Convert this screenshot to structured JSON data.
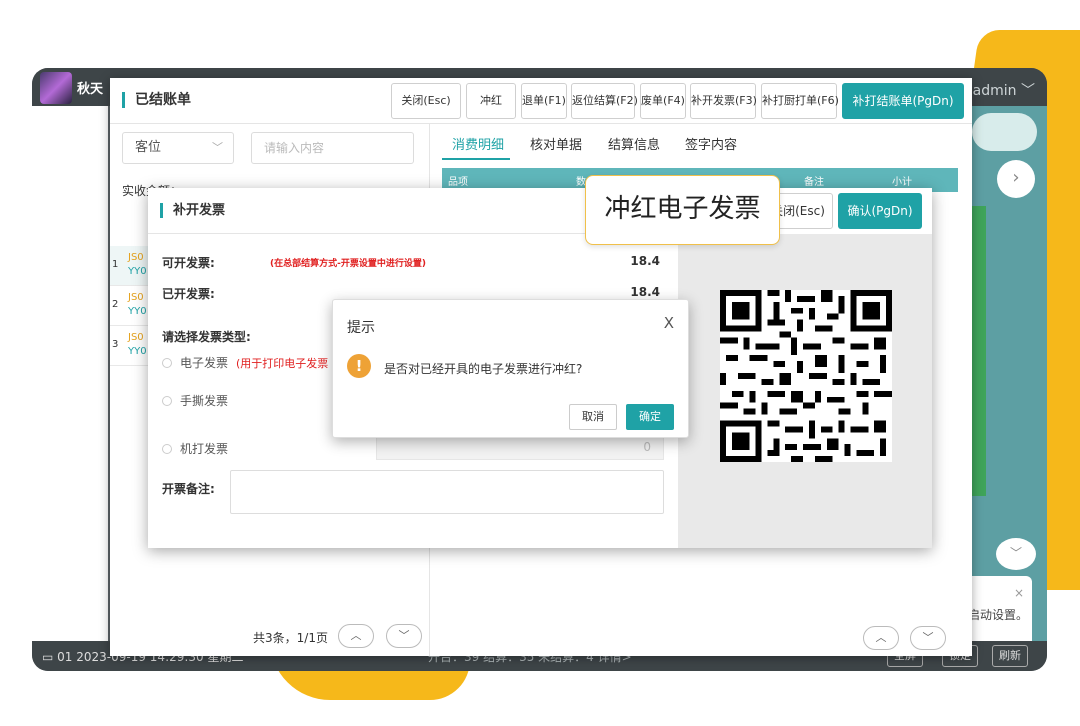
{
  "device": {
    "shop_name": "秋天",
    "user": "admin ﹀",
    "footer_left": "01 2023-09-19 14:29:30 星期二",
    "footer_mid": "开台：39  结算：35  未结算：4  详情>",
    "footer_btn1": "全屏",
    "footer_btn2": "锁定",
    "footer_btn3": "刷新",
    "notice_text": "启动设置。",
    "chevron_right": "›",
    "chevron_down": "﹀"
  },
  "window": {
    "title": "已结账单",
    "toolbar": {
      "close": "关闭(Esc)",
      "red": "冲红",
      "refund": "退单(F1)",
      "return_settle": "返位结算(F2)",
      "void": "废单(F4)",
      "reissue_invoice": "补开发票(F3)",
      "reprint_kitchen": "补打厨打单(F6)",
      "reprint_bill": "补打结账单(PgDn)"
    },
    "filter": {
      "select_value": "客位",
      "search_placeholder": "请输入内容",
      "received_label": "实收金额："
    },
    "list": [
      {
        "no": "1",
        "line1": "JS0",
        "line2": "YY0"
      },
      {
        "no": "2",
        "line1": "JS0",
        "line2": "YY0"
      },
      {
        "no": "3",
        "line1": "JS0",
        "line2": "YY0"
      }
    ],
    "pager": "共3条，1/1页",
    "tabs": [
      "消费明细",
      "核对单据",
      "结算信息",
      "签字内容"
    ],
    "table_headers": [
      "品项",
      "数",
      "备注",
      "小计"
    ]
  },
  "invoice": {
    "title": "补开发票",
    "close": "关闭(Esc)",
    "confirm": "确认(PgDn)",
    "available_label": "可开发票:",
    "available_note": "(在总部结算方式-开票设置中进行设置)",
    "available_value": "18.4",
    "issued_label": "已开发票:",
    "issued_value": "18.4",
    "type_label": "请选择发票类型:",
    "type_electronic": "电子发票",
    "type_electronic_hint": "(用于打印电子发票",
    "type_manual": "手撕发票",
    "type_machine": "机打发票",
    "machine_value": "0",
    "remark_label": "开票备注:"
  },
  "callout": "冲红电子发票",
  "prompt": {
    "title": "提示",
    "close": "X",
    "icon": "!",
    "message": "是否对已经开具的电子发票进行冲红?",
    "cancel": "取消",
    "ok": "确定"
  },
  "colors": {
    "accent": "#1fa2a6",
    "warning": "#eea236",
    "danger": "#e02020",
    "decor_yellow": "#f6b81a"
  }
}
